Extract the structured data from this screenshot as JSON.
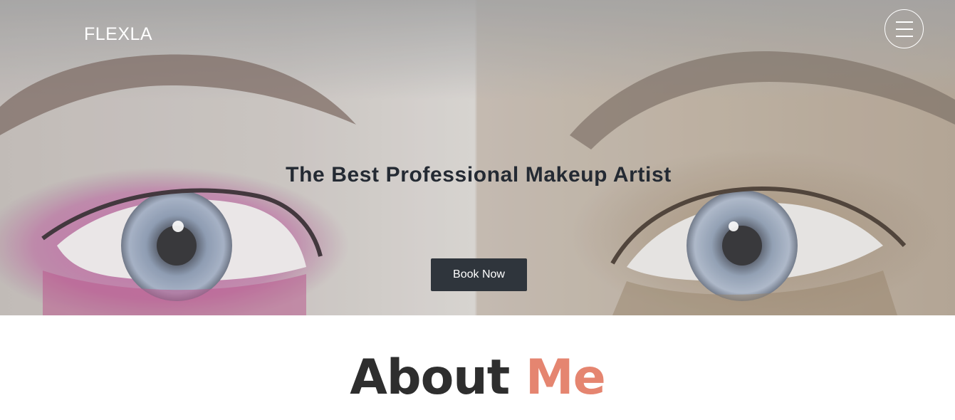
{
  "header": {
    "brand": "FLEXLA",
    "menu_icon": "hamburger-menu-icon"
  },
  "hero": {
    "title": "The Best Professional Makeup Artist",
    "cta_label": "Book Now",
    "image_description_icon": "eyes-makeup-image"
  },
  "about": {
    "heading_word1": "About",
    "heading_word2": "Me"
  },
  "colors": {
    "accent": "#e58570",
    "button_bg": "#2f353c",
    "title_text": "#242a33",
    "heading_dark": "#2e2e2e"
  }
}
